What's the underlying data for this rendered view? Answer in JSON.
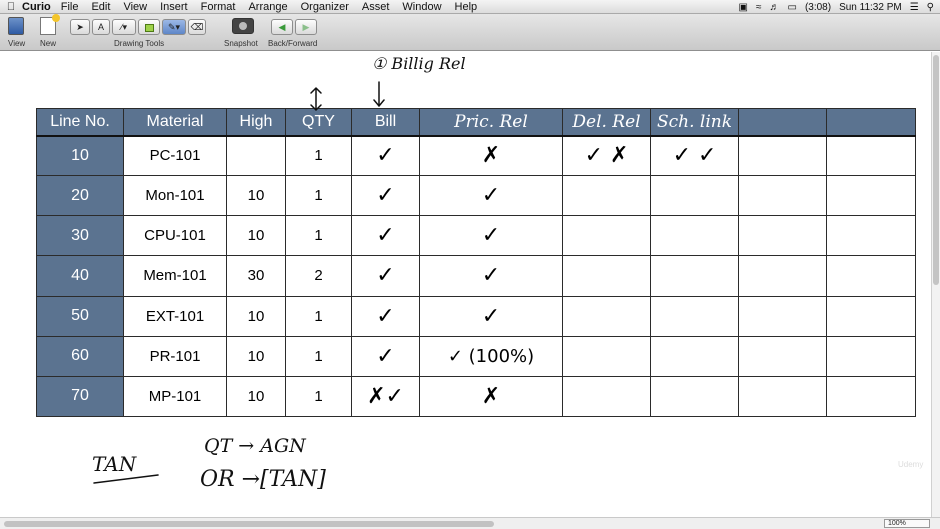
{
  "menubar": {
    "app_name": "Curio",
    "items": [
      "File",
      "Edit",
      "View",
      "Insert",
      "Format",
      "Arrange",
      "Organizer",
      "Asset",
      "Window",
      "Help"
    ],
    "battery": "(3:08)",
    "clock": "Sun 11:32 PM"
  },
  "toolbar": {
    "view_label": "View",
    "new_label": "New",
    "drawing_tools_label": "Drawing Tools",
    "snapshot_label": "Snapshot",
    "back_forward_label": "Back/Forward",
    "text_tool": "A"
  },
  "table": {
    "headers": [
      "Line No.",
      "Material",
      "High",
      "QTY",
      "Bill",
      "Pric. Rel",
      "Del. Rel",
      "Sch. link",
      "",
      ""
    ],
    "rows": [
      {
        "line": "10",
        "material": "PC-101",
        "high": "",
        "qty": "1",
        "bill": "✓",
        "price": "✗",
        "del": "✓  ✗",
        "sch": "✓  ✓"
      },
      {
        "line": "20",
        "material": "Mon-101",
        "high": "10",
        "qty": "1",
        "bill": "✓",
        "price": "✓",
        "del": "",
        "sch": ""
      },
      {
        "line": "30",
        "material": "CPU-101",
        "high": "10",
        "qty": "1",
        "bill": "✓",
        "price": "✓",
        "del": "",
        "sch": ""
      },
      {
        "line": "40",
        "material": "Mem-101",
        "high": "30",
        "qty": "2",
        "bill": "✓",
        "price": "✓",
        "del": "",
        "sch": ""
      },
      {
        "line": "50",
        "material": "EXT-101",
        "high": "10",
        "qty": "1",
        "bill": "✓",
        "price": "✓",
        "del": "",
        "sch": ""
      },
      {
        "line": "60",
        "material": "PR-101",
        "high": "10",
        "qty": "1",
        "bill": "✓",
        "price": "✓ (100%)",
        "del": "",
        "sch": ""
      },
      {
        "line": "70",
        "material": "MP-101",
        "high": "10",
        "qty": "1",
        "bill": "✗✓",
        "price": "✗",
        "del": "",
        "sch": ""
      }
    ]
  },
  "annotations": {
    "billing_rel": "① Billig Rel",
    "tan_left": "TAN",
    "qt_line": "QT → AGN",
    "or_line": "OR →[TAN]"
  },
  "status": {
    "zoom": "100%",
    "watermark": "Udemy"
  }
}
